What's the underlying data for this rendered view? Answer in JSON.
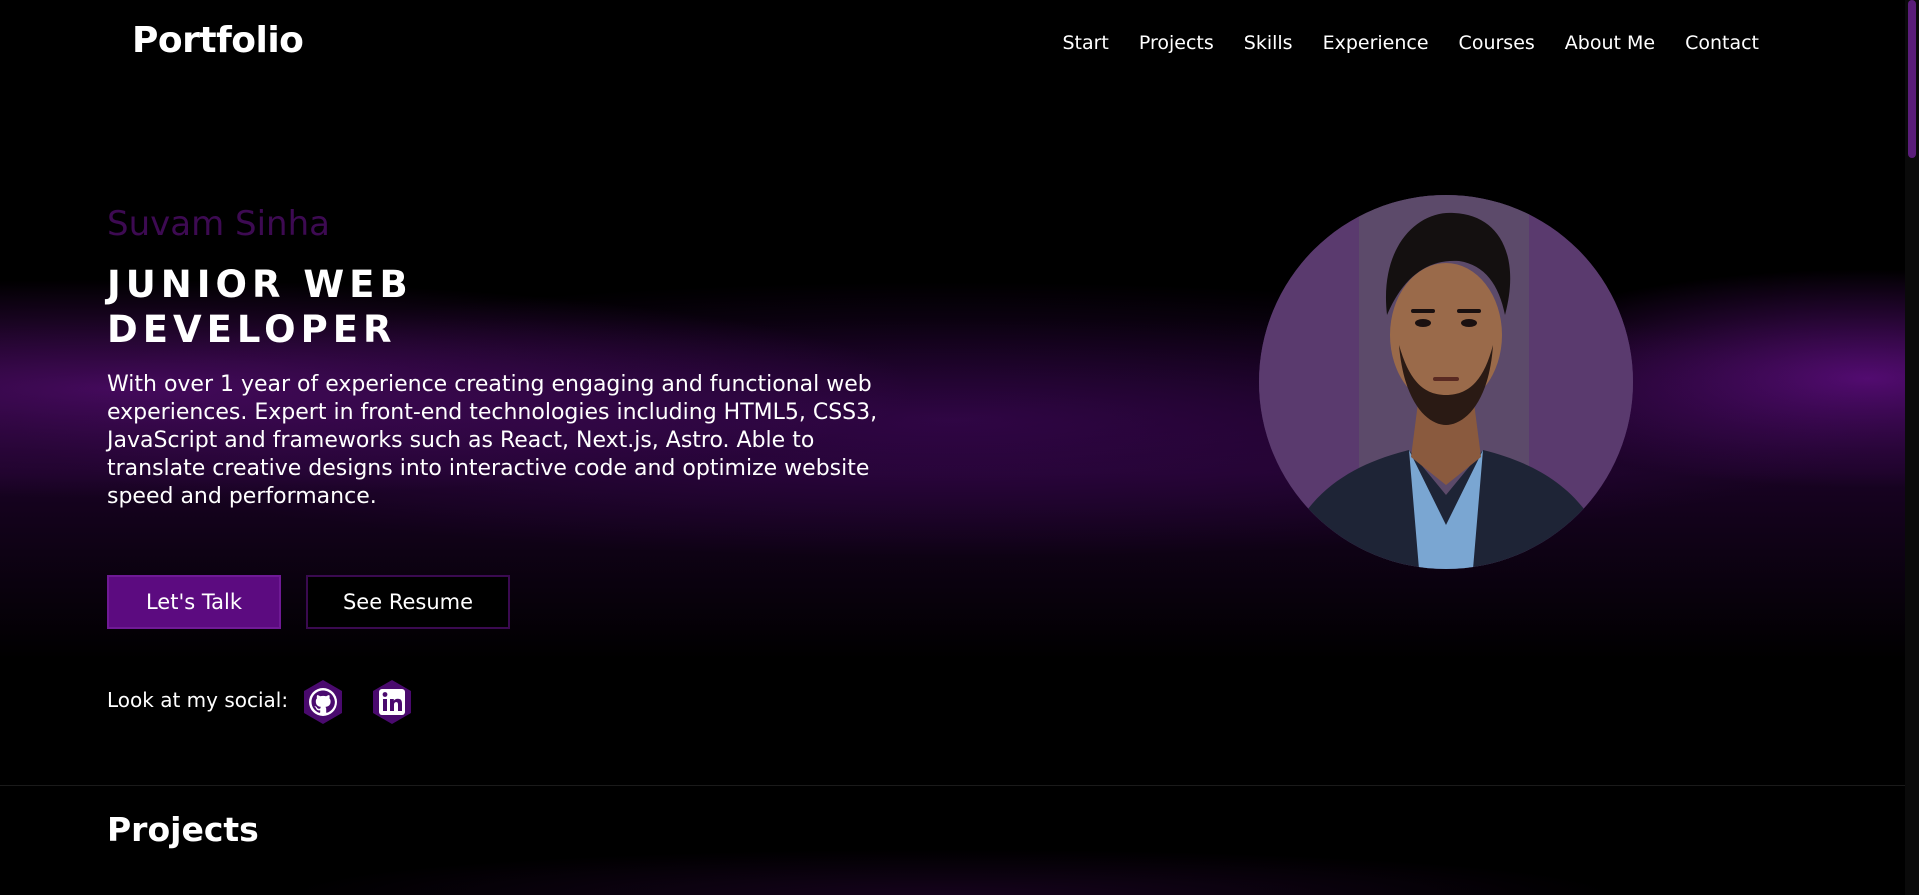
{
  "brand": {
    "logo": "Portfolio"
  },
  "nav": {
    "items": [
      {
        "label": "Start"
      },
      {
        "label": "Projects"
      },
      {
        "label": "Skills"
      },
      {
        "label": "Experience"
      },
      {
        "label": "Courses"
      },
      {
        "label": "About Me"
      },
      {
        "label": "Contact"
      }
    ]
  },
  "hero": {
    "name": "Suvam Sinha",
    "title_line1": "JUNIOR WEB",
    "title_line2": "DEVELOPER",
    "description": "With over 1 year of experience creating engaging and functional web experiences. Expert in front-end technologies including HTML5, CSS3, JavaScript and frameworks such as React, Next.js, Astro. Able to translate creative designs into interactive code and optimize website speed and performance.",
    "primary_button": "Let's Talk",
    "secondary_button": "See Resume",
    "social_label": "Look at my social:",
    "social_icons": [
      "github-icon",
      "linkedin-icon"
    ]
  },
  "sections": {
    "projects_title": "Projects"
  },
  "colors": {
    "background": "#000000",
    "accent": "#5c0b80",
    "name_color": "#3d0a52",
    "text": "#ffffff"
  }
}
